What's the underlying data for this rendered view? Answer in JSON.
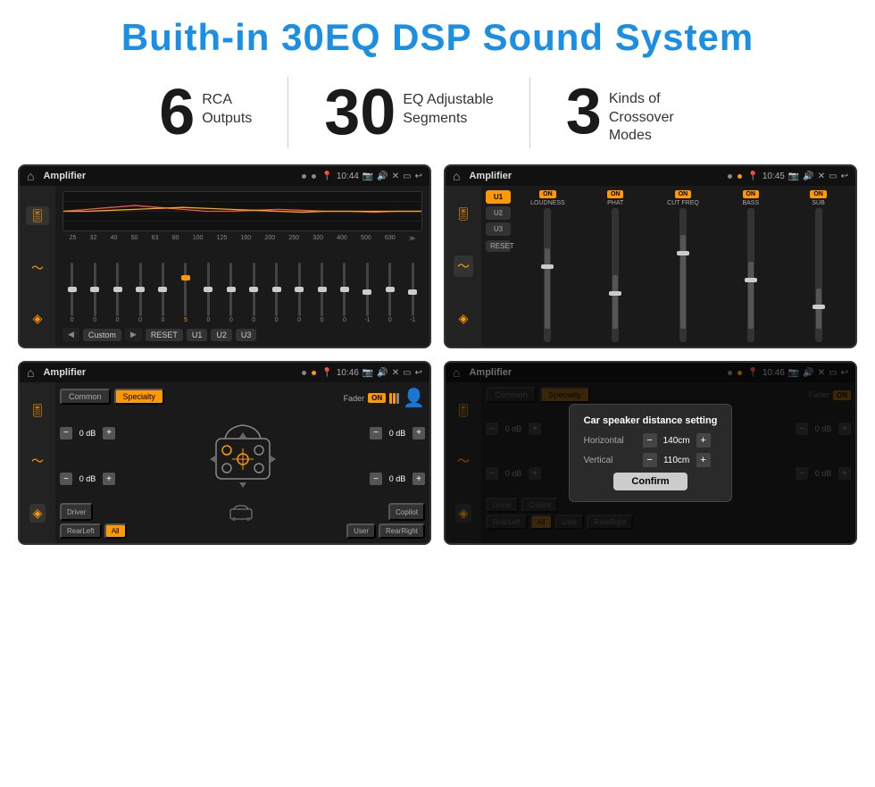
{
  "header": {
    "title": "Buith-in 30EQ DSP Sound System"
  },
  "stats": [
    {
      "number": "6",
      "label": "RCA\nOutputs"
    },
    {
      "number": "30",
      "label": "EQ Adjustable\nSegments"
    },
    {
      "number": "3",
      "label": "Kinds of\nCrossover Modes"
    }
  ],
  "screen1": {
    "title": "Amplifier",
    "time": "10:44",
    "freq_labels": [
      "25",
      "32",
      "40",
      "50",
      "63",
      "80",
      "100",
      "125",
      "160",
      "200",
      "250",
      "320",
      "400",
      "500",
      "630"
    ],
    "sliders": [
      0,
      0,
      0,
      0,
      0,
      5,
      0,
      0,
      0,
      0,
      0,
      0,
      0,
      -1,
      0,
      -1
    ],
    "buttons": [
      "Custom",
      "RESET",
      "U1",
      "U2",
      "U3"
    ]
  },
  "screen2": {
    "title": "Amplifier",
    "time": "10:45",
    "presets": [
      "U1",
      "U2",
      "U3"
    ],
    "channels": [
      "LOUDNESS",
      "PHAT",
      "CUT FREQ",
      "BASS",
      "SUB"
    ],
    "reset_label": "RESET"
  },
  "screen3": {
    "title": "Amplifier",
    "time": "10:46",
    "tabs": [
      "Common",
      "Specialty"
    ],
    "fader_label": "Fader",
    "db_controls": [
      {
        "value": "0 dB"
      },
      {
        "value": "0 dB"
      },
      {
        "value": "0 dB"
      },
      {
        "value": "0 dB"
      }
    ],
    "bottom_buttons": [
      "Driver",
      "",
      "Copilot",
      "RearLeft",
      "All",
      "",
      "User",
      "RearRight"
    ]
  },
  "screen4": {
    "title": "Amplifier",
    "time": "10:46",
    "dialog": {
      "title": "Car speaker distance setting",
      "horizontal_label": "Horizontal",
      "horizontal_value": "140cm",
      "vertical_label": "Vertical",
      "vertical_value": "110cm",
      "confirm_label": "Confirm"
    },
    "db_right_top": "0 dB",
    "db_right_bottom": "0 dB",
    "bottom_buttons": [
      "Driver",
      "Copilot",
      "RearLeft",
      "All",
      "User",
      "RearRight"
    ]
  },
  "icons": {
    "home": "⌂",
    "back": "↩",
    "settings": "⚙",
    "eq": "≋",
    "wave": "∿",
    "speaker": "◈",
    "camera": "📷",
    "volume": "🔊",
    "location": "📍"
  }
}
